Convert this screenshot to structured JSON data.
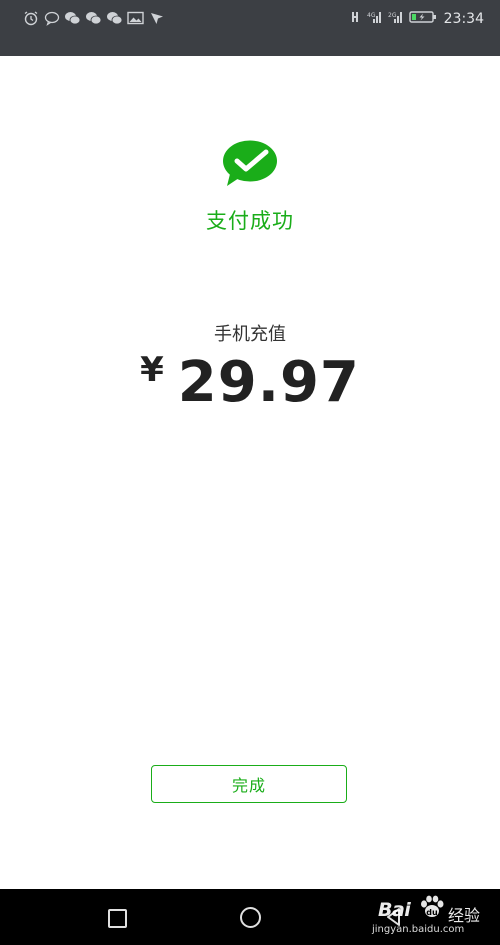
{
  "status_bar": {
    "time": "23:34",
    "left_icons": [
      "alarm-icon",
      "chat-bubble-icon",
      "wechat-icon",
      "wechat-icon",
      "wechat-icon",
      "gallery-icon",
      "navigation-icon"
    ],
    "right_icons": [
      "signal-icon",
      "signal-icon",
      "signal-icon",
      "battery-charging-icon"
    ]
  },
  "payment": {
    "status_text": "支付成功",
    "item_name": "手机充值",
    "currency_symbol": "¥",
    "amount": "29.97"
  },
  "actions": {
    "done_label": "完成"
  },
  "watermark": {
    "brand": "Bai",
    "brand_cn": "经验",
    "url": "jingyan.baidu.com"
  },
  "colors": {
    "accent": "#1aad19",
    "status_bar": "#3c3f44",
    "nav_bar": "#000000",
    "text_primary": "#222222"
  }
}
